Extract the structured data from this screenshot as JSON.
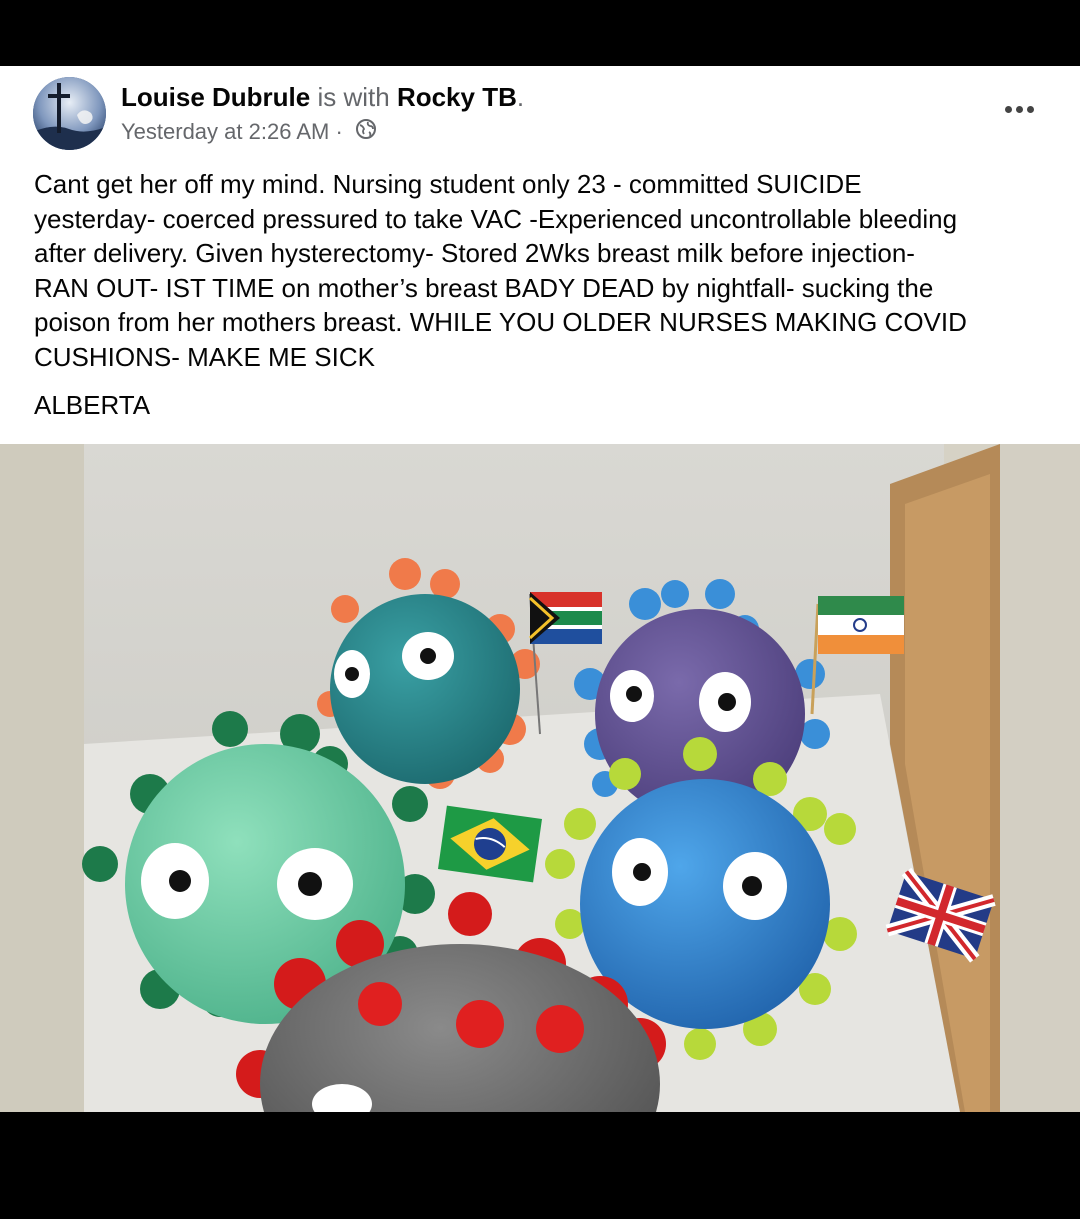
{
  "post": {
    "author": "Louise Dubrule",
    "with_text": " is with ",
    "tagged": "Rocky TB",
    "period": ".",
    "timestamp": "Yesterday at 2:26 AM",
    "separator": " · ",
    "privacy_icon": "globe-icon",
    "more_icon": "more-options-icon",
    "body_lines": [
      "Cant get her off my mind. Nursing student only 23 - committed SUICIDE",
      "yesterday- coerced pressured to take VAC -Experienced uncontrollable bleeding",
      "after delivery. Given hysterectomy- Stored 2Wks breast milk before injection-",
      "RAN OUT- IST TIME on mother’s breast BADY DEAD by nightfall- sucking the",
      "poison from her mothers breast. WHILE YOU OLDER NURSES MAKING COVID",
      "CUSHIONS- MAKE ME SICK"
    ],
    "location_line": "ALBERTA"
  },
  "colors": {
    "text_primary": "#050505",
    "text_secondary": "#65676b",
    "card_background": "#ffffff",
    "frame_background": "#000000"
  }
}
